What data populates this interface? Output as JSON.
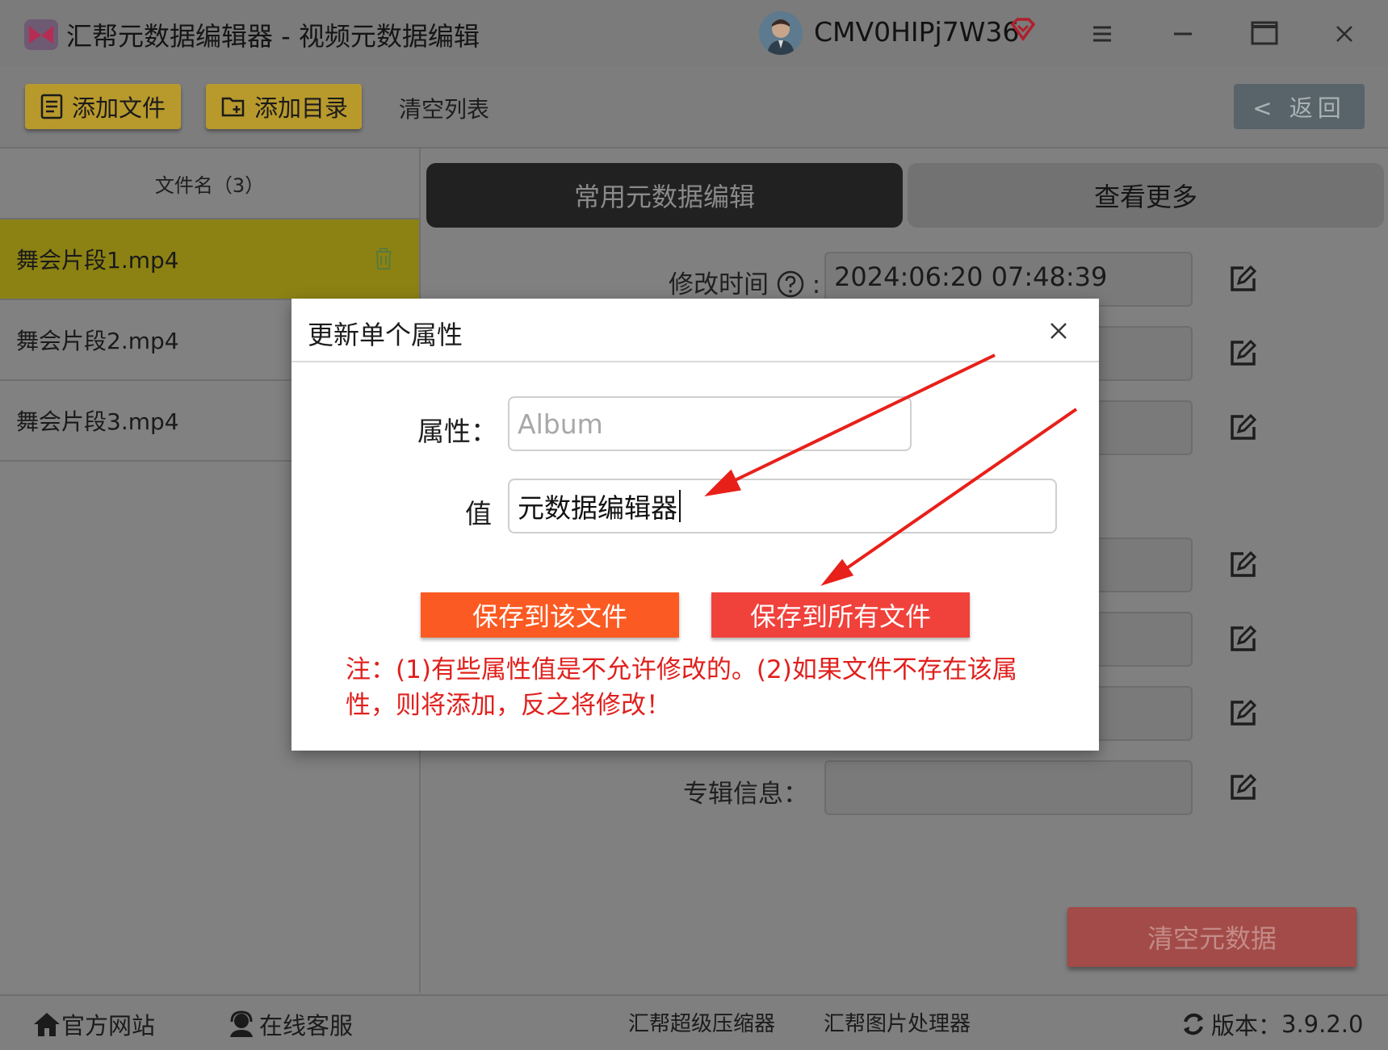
{
  "window": {
    "title": "汇帮元数据编辑器 - 视频元数据编辑",
    "username": "CMV0HIPj7W36"
  },
  "toolbar": {
    "add_file": "添加文件",
    "add_folder": "添加目录",
    "clear_list": "清空列表",
    "back": "< 返回"
  },
  "file_list": {
    "header": "文件名（3）",
    "items": [
      "舞会片段1.mp4",
      "舞会片段2.mp4",
      "舞会片段3.mp4"
    ],
    "selected_index": 0
  },
  "tabs": {
    "common": "常用元数据编辑",
    "more": "查看更多"
  },
  "fields": {
    "modified_time_label": "修改时间",
    "modified_time_value": "2024:06:20 07:48:39",
    "album_info_label": "专辑信息："
  },
  "clear_metadata": "清空元数据",
  "modal": {
    "title": "更新单个属性",
    "attribute_label": "属性：",
    "attribute_placeholder": "Album",
    "value_label": "值",
    "value": "元数据编辑器",
    "save_this": "保存到该文件",
    "save_all": "保存到所有文件",
    "note_line1": "注：(1)有些属性值是不允许修改的。(2)如果文件不存在该属",
    "note_line2": "性，则将添加，反之将修改！"
  },
  "statusbar": {
    "website": "官方网站",
    "support": "在线客服",
    "compressor": "汇帮超级压缩器",
    "image_tool": "汇帮图片处理器",
    "version_label": "版本：",
    "version": "3.9.2.0"
  },
  "colors": {
    "modal_save_this": "#fb5a22",
    "modal_save_all": "#f0413b",
    "note_red": "#e0201d",
    "annotation_arrow": "#e8201a"
  }
}
